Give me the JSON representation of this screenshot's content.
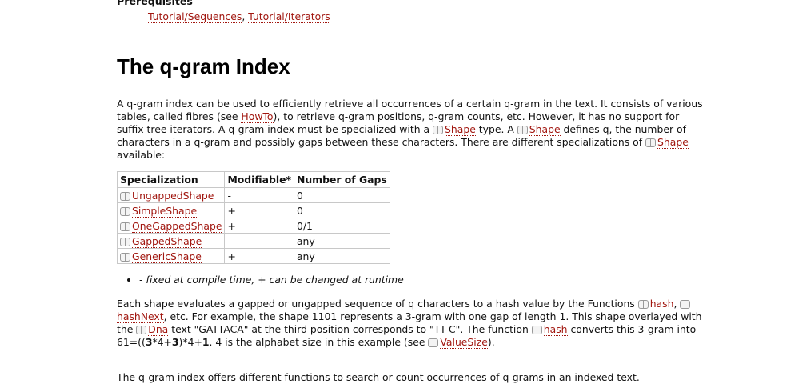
{
  "prerequisites": {
    "heading": "Prerequisites",
    "link1": "Tutorial/Sequences",
    "sep": ", ",
    "link2": "Tutorial/Iterators"
  },
  "title": "The q-gram Index",
  "intro": {
    "t1": "A q-gram index can be used to efficiently retrieve all occurrences of a certain q-gram in the text. It consists of various tables, called fibres (see ",
    "howto": "HowTo",
    "t2": "), to retrieve q-gram positions, q-gram counts, etc. However, it has no support for suffix tree iterators. A q-gram index must be specialized with a ",
    "shape": "Shape",
    "t3": " type. A ",
    "t4": " defines q, the number of characters in a q-gram and possibly gaps between these characters. There are different specializations of ",
    "t5": " available:"
  },
  "table": {
    "headers": [
      "Specialization",
      "Modifiable*",
      "Number of Gaps"
    ],
    "rows": [
      {
        "name": "UngappedShape",
        "mod": "-",
        "gaps": "0"
      },
      {
        "name": "SimpleShape",
        "mod": "+",
        "gaps": "0"
      },
      {
        "name": "OneGappedShape",
        "mod": "+",
        "gaps": "0/1"
      },
      {
        "name": "GappedShape",
        "mod": "-",
        "gaps": "any"
      },
      {
        "name": "GenericShape",
        "mod": "+",
        "gaps": "any"
      }
    ]
  },
  "note": "- fixed at compile time, + can be changed at runtime",
  "para2": {
    "t1": "Each shape evaluates a gapped or ungapped sequence of q characters to a hash value by the Functions ",
    "hash": "hash",
    "sep": ", ",
    "hashNext": "hashNext",
    "t2": ", etc. For example, the shape 1101 represents a 3-gram with one gap of length 1. This shape overlayed with the ",
    "dna": "Dna",
    "t3": " text \"GATTACA\" at the third position corresponds to \"TT-C\". The function ",
    "t4": " converts this 3-gram into 61=((",
    "b1": "3",
    "t5": "*4+",
    "b2": "3",
    "t6": ")*4+",
    "b3": "1",
    "t7": ". 4 is the alphabet size in this example (see ",
    "valueSize": "ValueSize",
    "t8": ")."
  },
  "para3": "The q-gram index offers different functions to search or count occurrences of q-grams in an indexed text."
}
